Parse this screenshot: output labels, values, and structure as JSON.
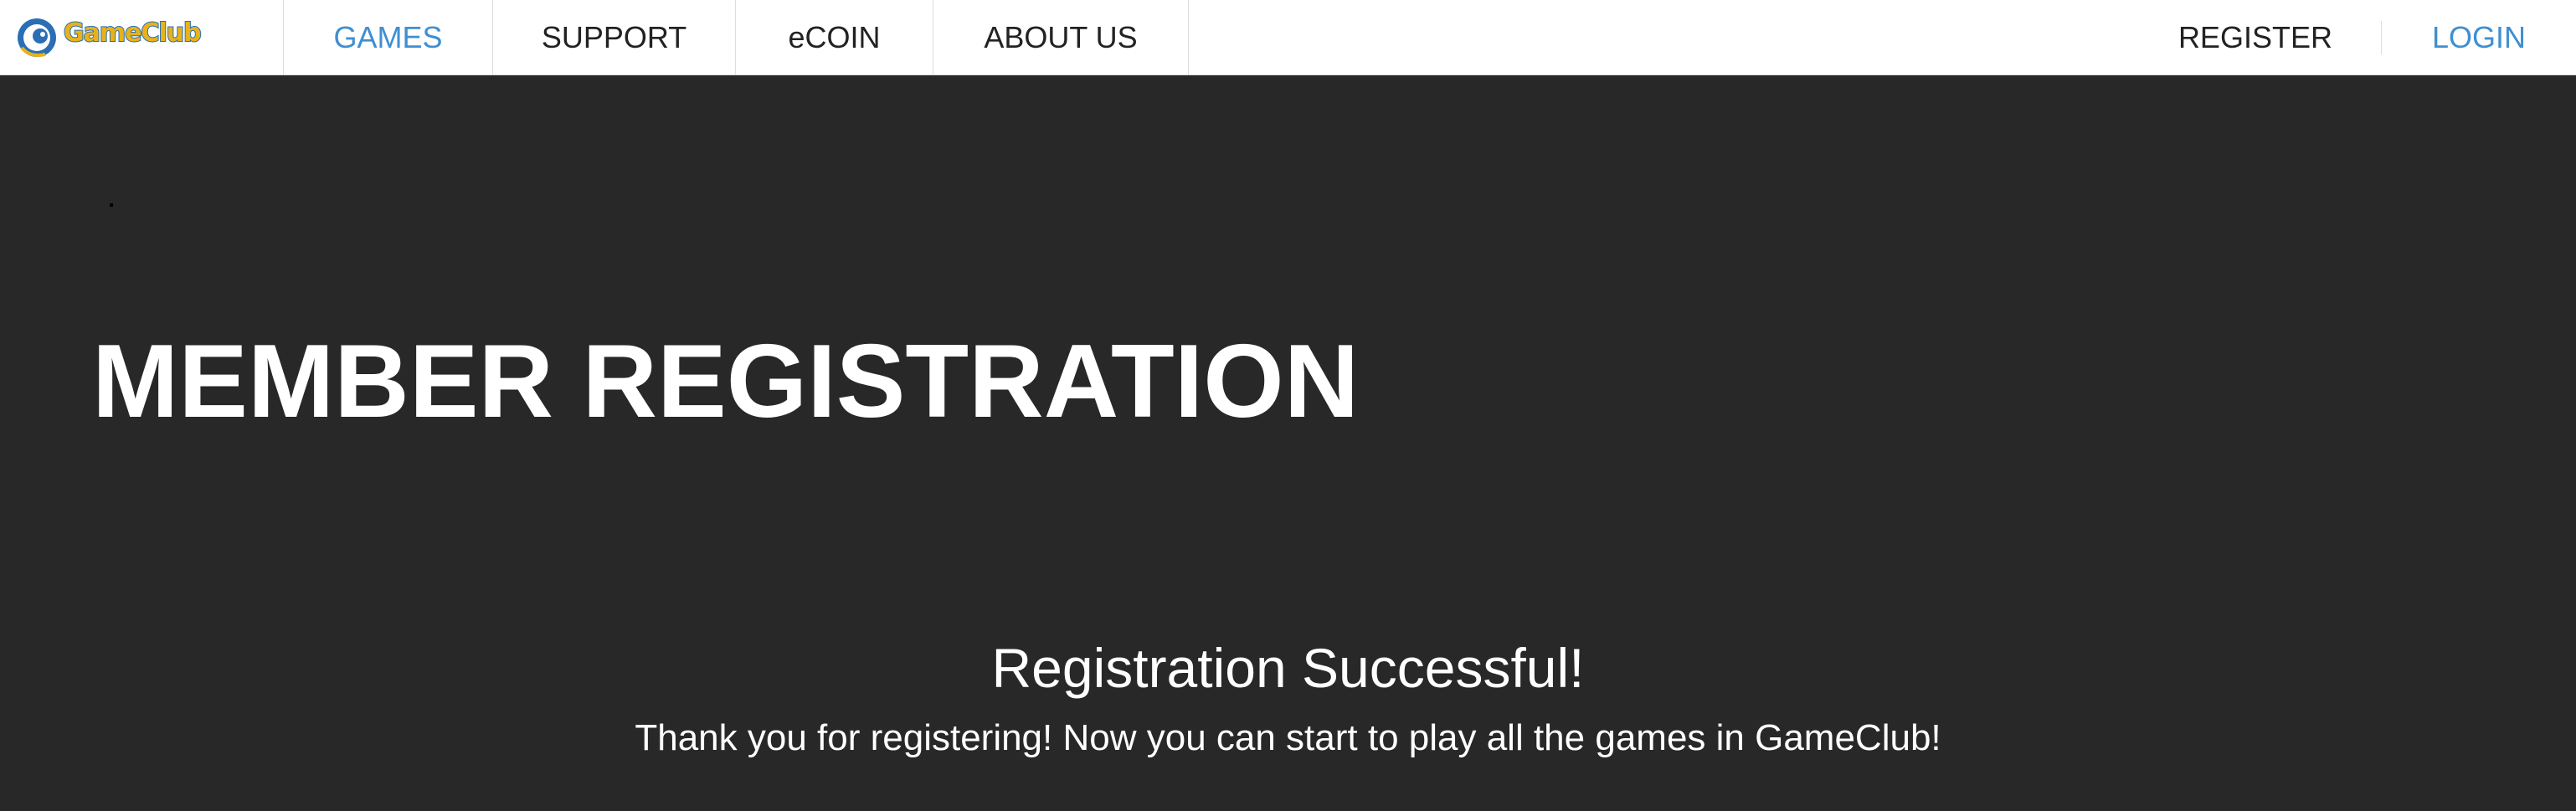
{
  "header": {
    "logo_text": "GameClub",
    "nav": [
      {
        "label": "GAMES",
        "active": true
      },
      {
        "label": "SUPPORT",
        "active": false
      },
      {
        "label": "eCOIN",
        "active": false
      },
      {
        "label": "ABOUT US",
        "active": false
      }
    ],
    "register_label": "REGISTER",
    "login_label": "LOGIN"
  },
  "main": {
    "title": "MEMBER REGISTRATION",
    "success_title": "Registration Successful!",
    "success_message": "Thank you for registering! Now you can start to play all the games in GameClub!"
  },
  "colors": {
    "background": "#282828",
    "accent": "#3f8fd2",
    "header_bg": "#ffffff"
  }
}
